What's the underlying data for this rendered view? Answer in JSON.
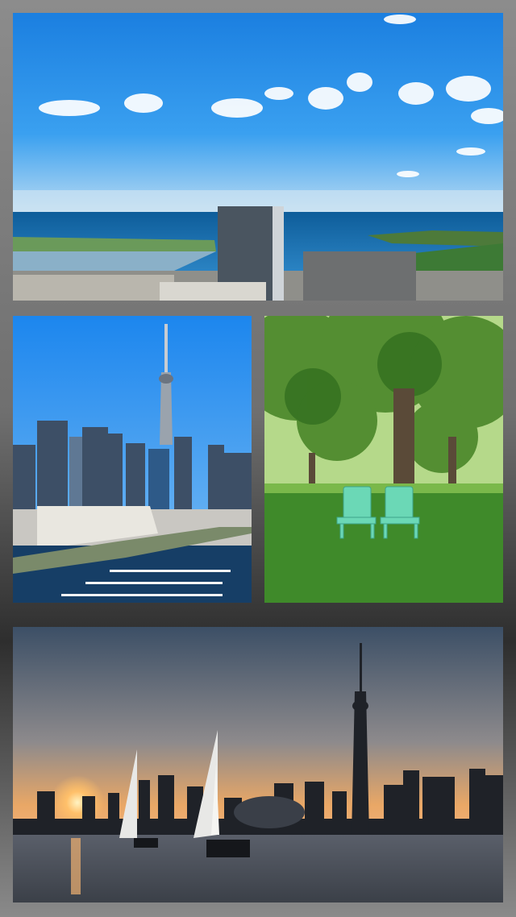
{
  "collage": {
    "photos": [
      {
        "subject": "lakefront-aerial-view"
      },
      {
        "subject": "city-skyline-with-harbour"
      },
      {
        "subject": "park-with-muskoka-chairs"
      },
      {
        "subject": "sunset-skyline-with-sailboats"
      }
    ],
    "colors": {
      "sky_blue": "#1e8fe8",
      "lake_blue": "#1a73b8",
      "grass_green": "#3f8a2a",
      "chair_teal": "#67d8b6",
      "sunset_orange": "#f0a050"
    }
  }
}
